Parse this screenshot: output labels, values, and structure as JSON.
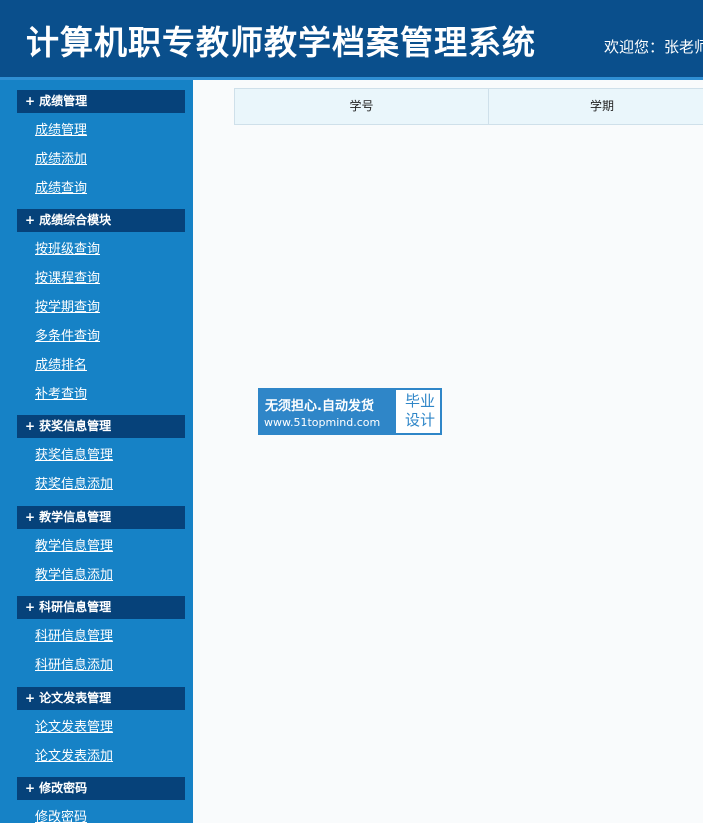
{
  "header": {
    "title": "计算机职专教师教学档案管理系统",
    "welcome": "欢迎您：张老师"
  },
  "sidebar": {
    "plus_symbol": "+",
    "groups": [
      {
        "title": "成绩管理",
        "links": [
          "成绩管理",
          "成绩添加",
          "成绩查询"
        ]
      },
      {
        "title": "成绩综合模块",
        "links": [
          "按班级查询",
          "按课程查询",
          "按学期查询",
          "多条件查询",
          "成绩排名",
          "补考查询"
        ]
      },
      {
        "title": "获奖信息管理",
        "links": [
          "获奖信息管理",
          "获奖信息添加"
        ]
      },
      {
        "title": "教学信息管理",
        "links": [
          "教学信息管理",
          "教学信息添加"
        ]
      },
      {
        "title": "科研信息管理",
        "links": [
          "科研信息管理",
          "科研信息添加"
        ]
      },
      {
        "title": "论文发表管理",
        "links": [
          "论文发表管理",
          "论文发表添加"
        ]
      },
      {
        "title": "修改密码",
        "links": [
          "修改密码"
        ]
      }
    ]
  },
  "table": {
    "columns": [
      "学号",
      "学期"
    ]
  },
  "watermark": {
    "line1": "无须担心.自动发货",
    "line2": "www.51topmind.com",
    "right_top": "毕业",
    "right_bottom": "设计"
  },
  "colors": {
    "header_bg": "#0a4f8c",
    "sidebar_bg": "#1682c6",
    "group_header_bg": "#06427a",
    "table_header_bg": "#eaf6fb",
    "watermark_blue": "#2f86c8"
  }
}
